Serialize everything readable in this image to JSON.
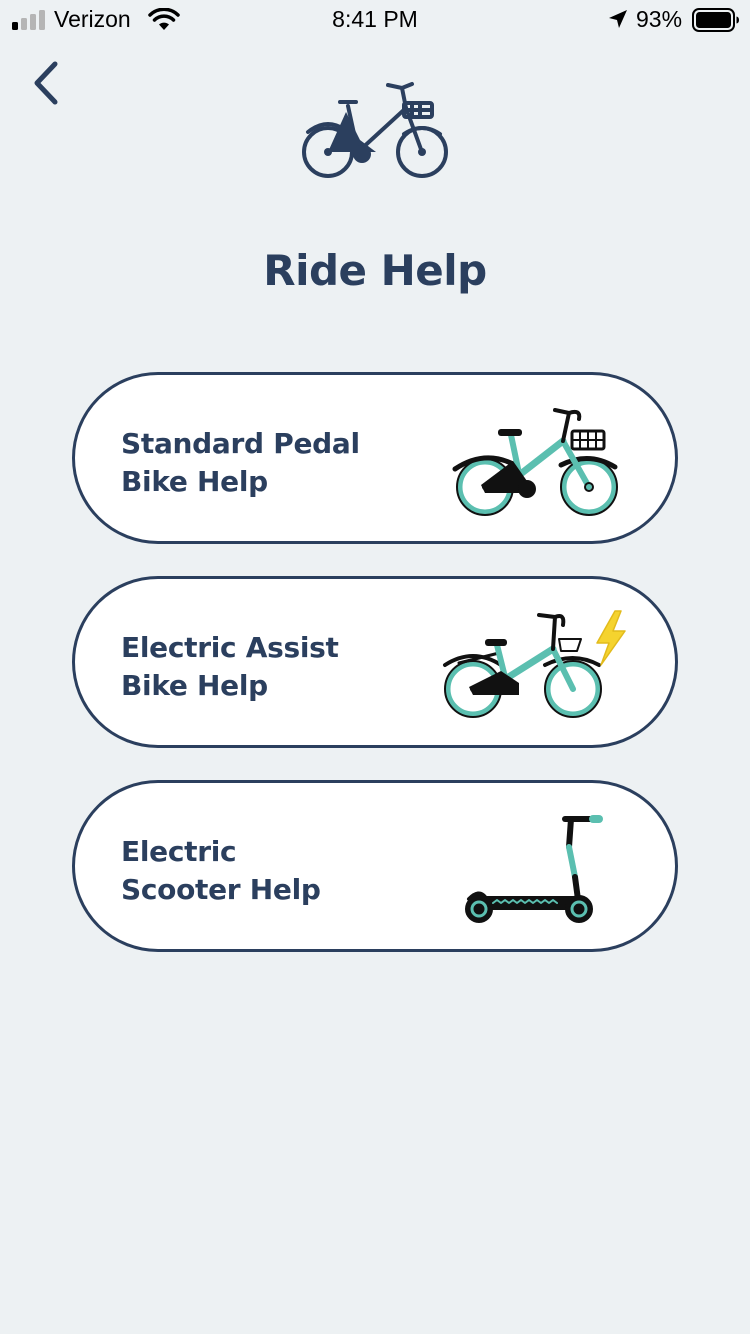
{
  "status_bar": {
    "carrier": "Verizon",
    "time": "8:41 PM",
    "battery_percent": "93%",
    "signal_bars_active": 1,
    "signal_bars_total": 4,
    "battery_level": 0.93
  },
  "header": {
    "back_icon": "chevron-left-icon",
    "logo_icon": "bike-icon",
    "title": "Ride Help"
  },
  "options": [
    {
      "line1": "Standard Pedal",
      "line2": "Bike Help",
      "icon": "pedal-bike-icon"
    },
    {
      "line1": "Electric Assist",
      "line2": "Bike Help",
      "icon": "electric-bike-icon"
    },
    {
      "line1": "Electric",
      "line2": "Scooter Help",
      "icon": "electric-scooter-icon"
    }
  ],
  "colors": {
    "background": "#edf1f3",
    "navy": "#2b3f5e",
    "teal": "#5bbfb0",
    "bolt_yellow": "#f5d32e"
  }
}
